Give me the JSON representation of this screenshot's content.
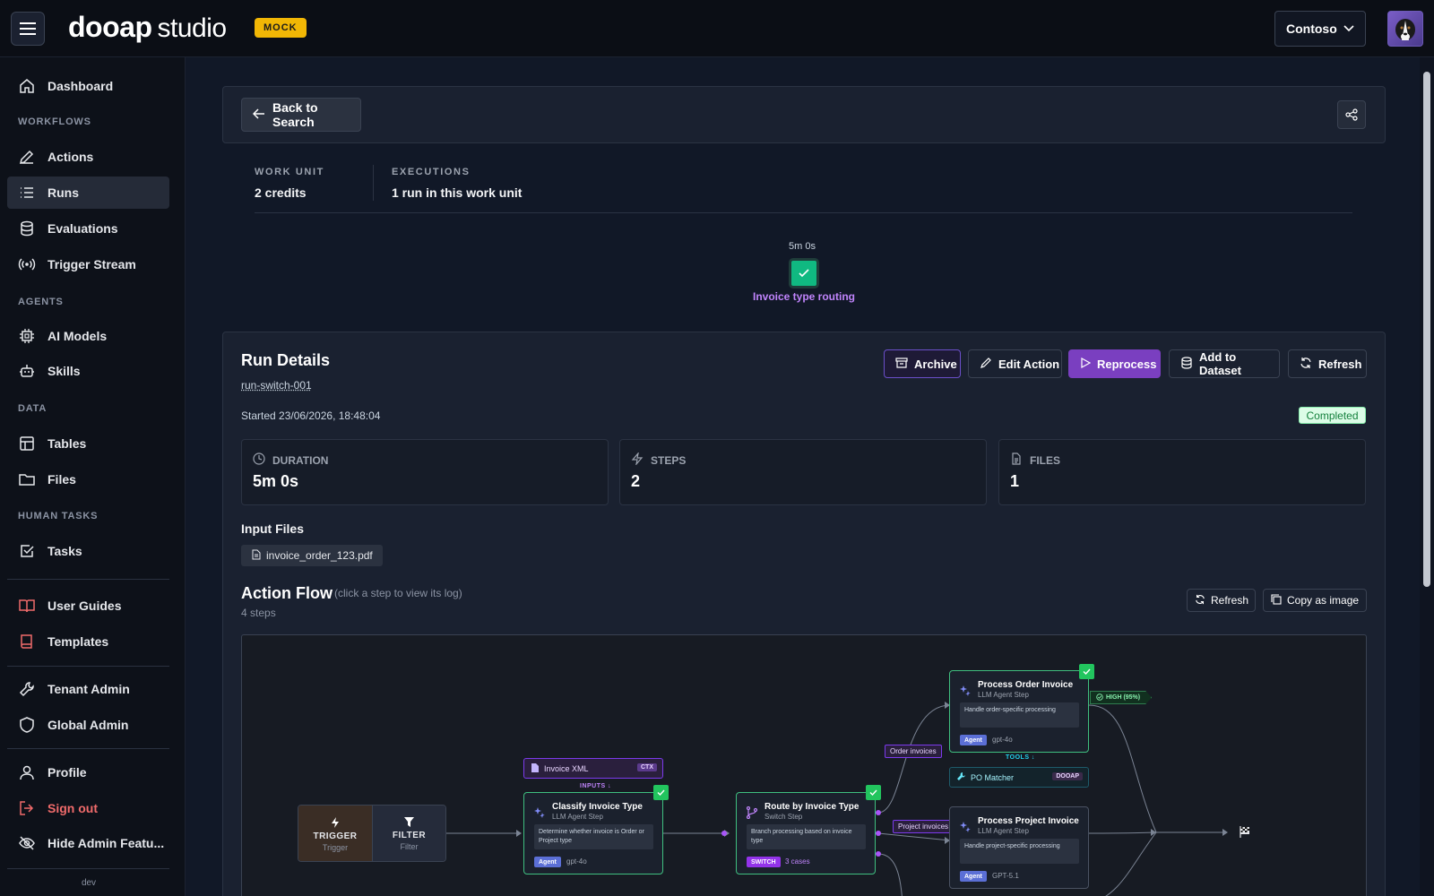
{
  "header": {
    "logo_main": "dooap",
    "logo_sub": "studio",
    "badge": "MOCK",
    "tenant": "Contoso"
  },
  "sidebar": {
    "dashboard": "Dashboard",
    "section_workflows": "WORKFLOWS",
    "actions": "Actions",
    "runs": "Runs",
    "evaluations": "Evaluations",
    "trigger_stream": "Trigger Stream",
    "section_agents": "AGENTS",
    "ai_models": "AI Models",
    "skills": "Skills",
    "section_data": "DATA",
    "tables": "Tables",
    "files": "Files",
    "section_human_tasks": "HUMAN TASKS",
    "tasks": "Tasks",
    "user_guides": "User Guides",
    "templates": "Templates",
    "tenant_admin": "Tenant Admin",
    "global_admin": "Global Admin",
    "profile": "Profile",
    "sign_out": "Sign out",
    "hide_admin": "Hide Admin Featu...",
    "env": "dev"
  },
  "top_panel": {
    "back_label": "Back to Search"
  },
  "work_unit": {
    "label": "WORK UNIT",
    "value": "2 credits",
    "exec_label": "EXECUTIONS",
    "exec_value": "1 run in this work unit"
  },
  "timeline": {
    "duration": "5m 0s",
    "name": "Invoice type routing"
  },
  "run": {
    "title": "Run Details",
    "id": "run-switch-001",
    "started": "Started 23/06/2026, 18:48:04",
    "status": "Completed",
    "buttons": {
      "archive": "Archive",
      "edit": "Edit Action",
      "reprocess": "Reprocess",
      "add_dataset": "Add to Dataset",
      "refresh": "Refresh"
    },
    "stats": {
      "duration_label": "DURATION",
      "duration_value": "5m 0s",
      "steps_label": "STEPS",
      "steps_value": "2",
      "files_label": "FILES",
      "files_value": "1"
    },
    "input_files_title": "Input Files",
    "input_file": "invoice_order_123.pdf"
  },
  "flow": {
    "title": "Action Flow",
    "hint": "(click a step to view its log)",
    "steps_count": "4 steps",
    "refresh": "Refresh",
    "copy": "Copy as image",
    "trigger_name": "TRIGGER",
    "trigger_sub": "Trigger",
    "filter_name": "FILTER",
    "filter_sub": "Filter",
    "ctx_name": "Invoice XML",
    "ctx_tag": "CTX",
    "inputs_label": "INPUTS",
    "classify": {
      "name": "Classify Invoice Type",
      "sub": "LLM Agent Step",
      "desc": "Determine whether invoice is Order or Project type",
      "tag": "Agent",
      "model": "gpt-4o"
    },
    "route": {
      "name": "Route by Invoice Type",
      "sub": "Switch Step",
      "desc": "Branch processing based on invoice type",
      "tag": "SWITCH",
      "cases": "3 cases"
    },
    "edge_order": "Order invoices",
    "edge_project": "Project invoices",
    "order": {
      "name": "Process Order Invoice",
      "sub": "LLM Agent Step",
      "desc": "Handle order-specific processing",
      "tag": "Agent",
      "model": "gpt-4o"
    },
    "confidence": "HIGH (95%)",
    "tools_label": "TOOLS",
    "tool_name": "PO Matcher",
    "tool_tag": "DOOAP",
    "project": {
      "name": "Process Project Invoice",
      "sub": "LLM Agent Step",
      "desc": "Handle project-specific processing",
      "tag": "Agent",
      "model": "GPT-5.1"
    }
  },
  "colors": {
    "accent_purple": "#7a3fc0",
    "success_green": "#10b981",
    "badge_yellow": "#f2b705"
  }
}
